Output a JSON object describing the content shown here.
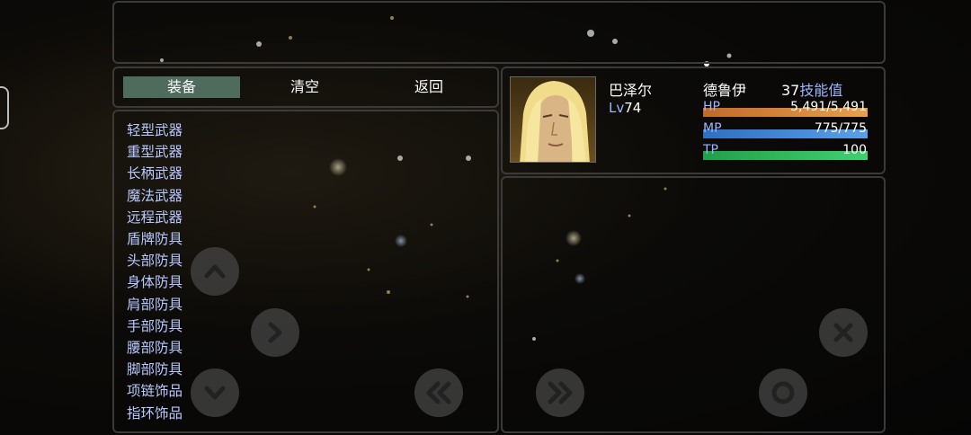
{
  "commands": {
    "equip": "装备",
    "clear": "清空",
    "back": "返回"
  },
  "categories": [
    "轻型武器",
    "重型武器",
    "长柄武器",
    "魔法武器",
    "远程武器",
    "盾牌防具",
    "头部防具",
    "身体防具",
    "肩部防具",
    "手部防具",
    "腰部防具",
    "脚部防具",
    "项链饰品",
    "指环饰品"
  ],
  "actor": {
    "name": "巴泽尔",
    "class": "德鲁伊",
    "level_label": "Lv",
    "level": "74",
    "skill_points": "37",
    "skill_label": "技能值",
    "hp_label": "HP",
    "hp_value": "5,491/5,491",
    "hp_fill": 1.0,
    "mp_label": "MP",
    "mp_value": "775/775",
    "mp_fill": 1.0,
    "tp_label": "TP",
    "tp_value": "100",
    "tp_fill": 1.0
  },
  "colors": {
    "hp": "#d8843a",
    "mp": "#3f7fd0",
    "tp": "#2eb85a",
    "label": "#9fb4ff",
    "cat": "#b8c8ff"
  },
  "buttons": [
    "up-icon",
    "right-icon",
    "down-icon",
    "page-left-icon",
    "page-right-icon",
    "close-icon",
    "confirm-icon"
  ]
}
